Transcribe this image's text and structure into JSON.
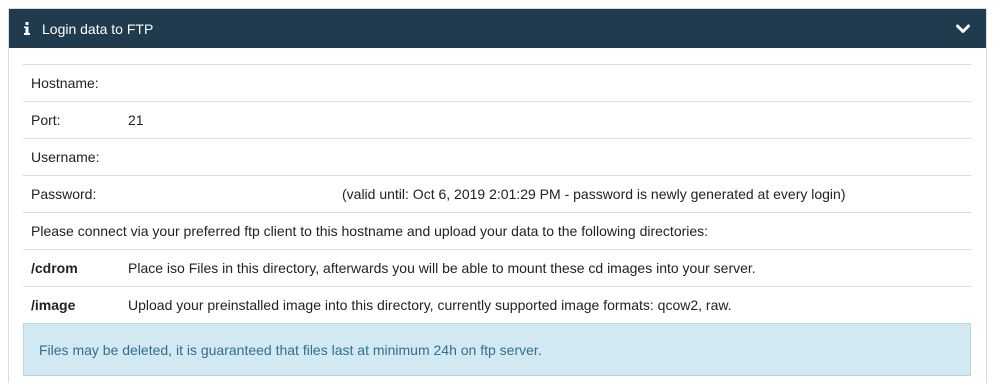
{
  "panel": {
    "title": "Login data to FTP",
    "header_color": "#1f3b4d"
  },
  "rows": {
    "hostname": {
      "label": "Hostname:",
      "value": ""
    },
    "port": {
      "label": "Port:",
      "value": "21"
    },
    "username": {
      "label": "Username:",
      "value": ""
    },
    "password": {
      "label": "Password:",
      "value": "",
      "note": "(valid until: Oct 6, 2019 2:01:29 PM - password is newly generated at every login)"
    },
    "instructions": "Please connect via your preferred ftp client to this hostname and upload your data to the following directories:",
    "cdrom": {
      "label": "/cdrom",
      "description": "Place iso Files in this directory, afterwards you will be able to mount these cd images into your server."
    },
    "image": {
      "label": "/image",
      "description": "Upload your preinstalled image into this directory, currently supported image formats: qcow2, raw."
    }
  },
  "alert": {
    "text": "Files may be deleted, it is guaranteed that files last at minimum 24h on ftp server."
  },
  "icons": {
    "info": "info-icon",
    "toggle": "chevron-down-icon"
  }
}
